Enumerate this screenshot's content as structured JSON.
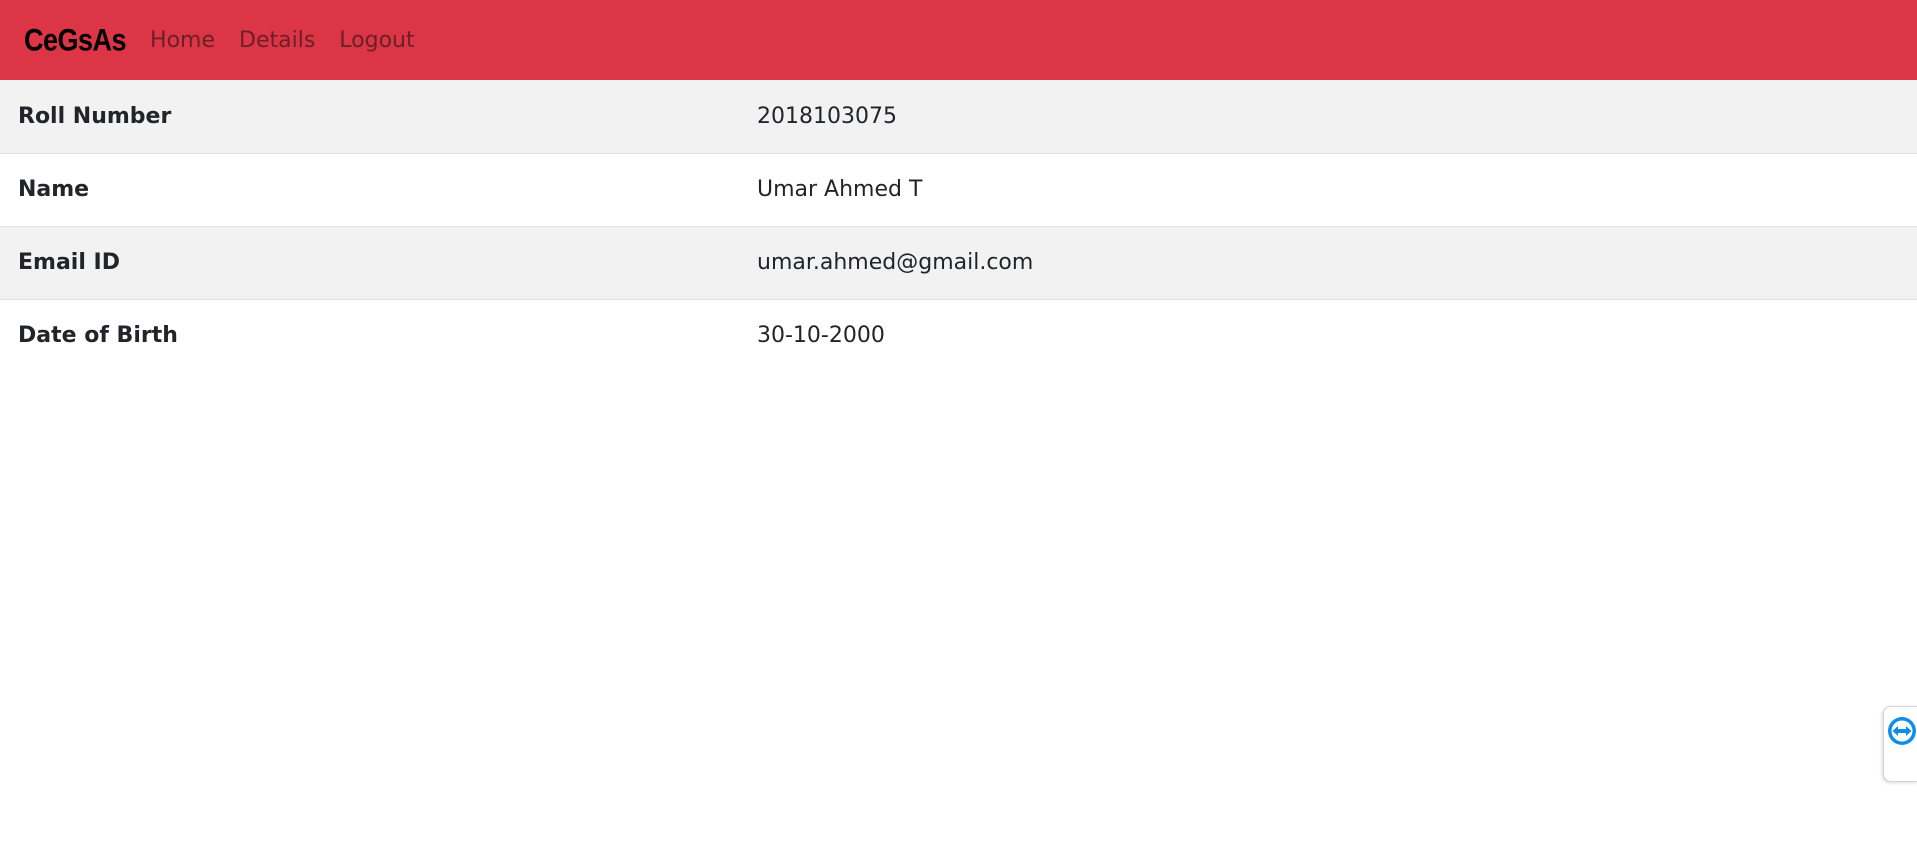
{
  "navbar": {
    "brand": "CeGsAs",
    "links": [
      "Home",
      "Details",
      "Logout"
    ],
    "background": "#dc3545"
  },
  "details": {
    "rows": [
      {
        "label": "Roll Number",
        "value": "2018103075"
      },
      {
        "label": "Name",
        "value": "Umar Ahmed T"
      },
      {
        "label": "Email ID",
        "value": "umar.ahmed@gmail.com"
      },
      {
        "label": "Date of Birth",
        "value": "30-10-2000"
      }
    ]
  },
  "widget": {
    "icon": "teamviewer-icon",
    "color": "#0e8ee9"
  }
}
